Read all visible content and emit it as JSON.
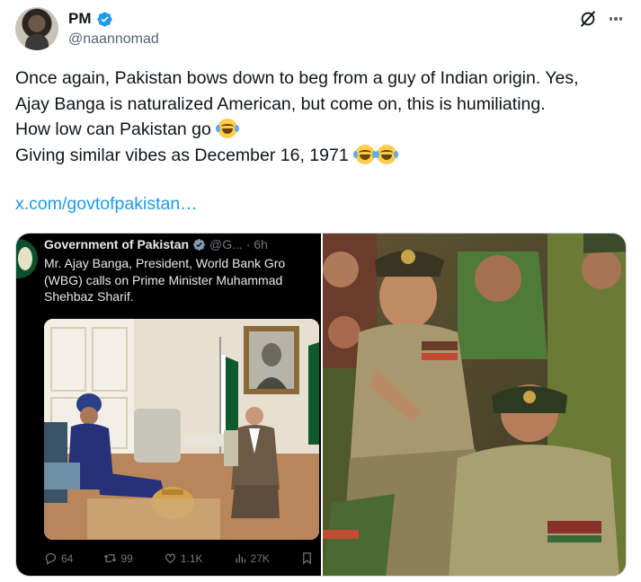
{
  "author": {
    "display_name": "PM",
    "handle": "@naannomad"
  },
  "tweet": {
    "lines": [
      "Once again, Pakistan bows down to beg from a guy of Indian origin. Yes,",
      "Ajay Banga is naturalized American, but come on, this is humiliating.",
      "How low can Pakistan go",
      "Giving similar vibes as December 16, 1971"
    ],
    "link": "x.com/govtofpakistan…"
  },
  "embedded": {
    "display_name": "Government of Pakistan",
    "handle": "@G...",
    "time": "· 6h",
    "text_lines": [
      "Mr. Ajay Banga, President, World Bank Gro",
      "(WBG) calls on Prime Minister Muhammad",
      "Shehbaz Sharif."
    ],
    "stats": {
      "replies": "64",
      "reposts": "99",
      "likes": "1.1K",
      "views": "27K"
    }
  },
  "colors": {
    "verified": "#1d9bf0",
    "link": "#1d9bf0",
    "secondary_text": "#536471",
    "embedded_bg": "#000000"
  },
  "icons": [
    "verified-badge-icon",
    "grok-icon",
    "more-icon",
    "reply-icon",
    "repost-icon",
    "like-icon",
    "views-icon",
    "bookmark-icon",
    "laughing-crying-emoji"
  ]
}
